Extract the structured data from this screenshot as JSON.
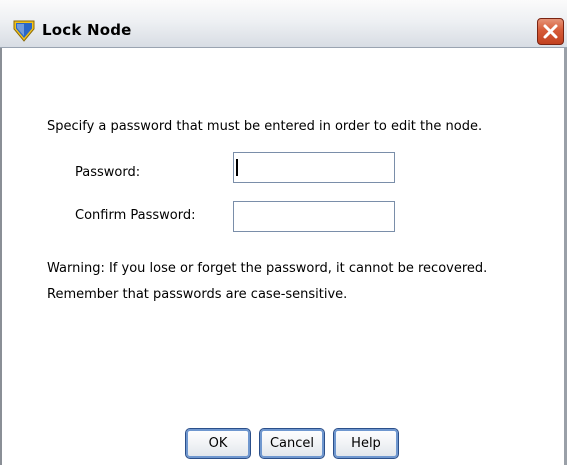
{
  "window": {
    "title": "Lock Node",
    "icon": "shield-icon",
    "close_icon": "close-icon"
  },
  "dialog": {
    "instruction": "Specify a password that must be entered in order to edit the node.",
    "password_label": "Password:",
    "password_value": "",
    "confirm_label": "Confirm Password:",
    "confirm_value": "",
    "warning_line1": "Warning: If you lose or forget the password, it cannot be recovered.",
    "warning_line2": "Remember that passwords are case-sensitive."
  },
  "buttons": {
    "ok": "OK",
    "cancel": "Cancel",
    "help": "Help"
  },
  "colors": {
    "close_button": "#d65b38",
    "icon_gold": "#f3c21a",
    "icon_blue": "#2a67c8",
    "field_border": "#7a8ea9",
    "button_border": "#2b4f8a"
  }
}
